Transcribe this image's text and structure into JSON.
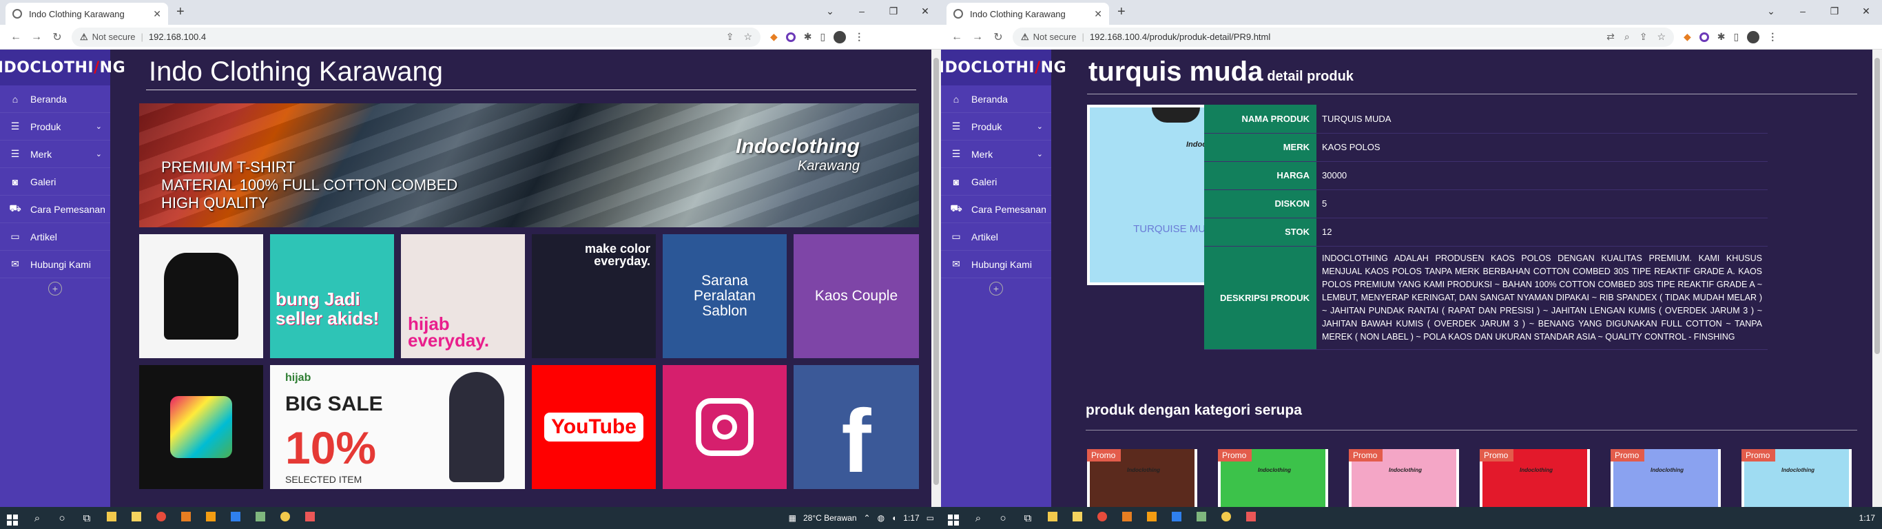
{
  "left": {
    "tab_title": "Indo Clothing Karawang",
    "not_secure": "Not secure",
    "url": "192.168.100.4",
    "logo_pre": "INDOCLOTHI",
    "logo_slash": "/",
    "logo_post": "NG",
    "site_title": "Indo Clothing Karawang",
    "hero": {
      "line1": "PREMIUM T-SHIRT",
      "line2": "MATERIAL 100% FULL COTTON COMBED",
      "line3": "HIGH QUALITY",
      "brand": "Indoclothing",
      "brand_sub": "Karawang"
    },
    "tiles": {
      "kids": "bung Jadi seller akids!",
      "hijab": "hijab everyday.",
      "stack": "make color everyday.",
      "alat": "Sarana Peralatan Sablon",
      "couple": "Kaos Couple",
      "sale_brand": "hijab",
      "sale_big": "BIG SALE",
      "sale_pct": "10%",
      "sale_off": "SELECTED ITEM",
      "youtube": "YouTube",
      "facebook": "f"
    }
  },
  "right": {
    "tab_title": "Indo Clothing Karawang",
    "not_secure": "Not secure",
    "url": "192.168.100.4/produk/produk-detail/PR9.html",
    "product_name_title": "turquis muda",
    "product_subtitle": "detail produk",
    "image_label": "TURQUISE MUDA",
    "image_brand": "Indoclothing",
    "details": [
      {
        "k": "NAMA PRODUK",
        "v": "TURQUIS MUDA"
      },
      {
        "k": "MERK",
        "v": "KAOS POLOS"
      },
      {
        "k": "HARGA",
        "v": "30000"
      },
      {
        "k": "DISKON",
        "v": "5"
      },
      {
        "k": "STOK",
        "v": "12"
      }
    ],
    "desc_label": "DESKRIPSI PRODUK",
    "desc_text": "INDOCLOTHING ADALAH PRODUSEN KAOS POLOS DENGAN KUALITAS PREMIUM. KAMI KHUSUS MENJUAL KAOS POLOS TANPA MERK BERBAHAN COTTON COMBED 30S TIPE REAKTIF GRADE A. KAOS POLOS PREMIUM YANG KAMI PRODUKSI ~ BAHAN 100% COTTON COMBED 30S TIPE REAKTIF GRADE A ~ LEMBUT, MENYERAP KERINGAT, DAN SANGAT NYAMAN DIPAKAI ~ RIB SPANDEX ( TIDAK MUDAH MELAR ) ~ JAHITAN PUNDAK RANTAI ( RAPAT DAN PRESISI ) ~ JAHITAN LENGAN KUMIS ( OVERDEK JARUM 3 ) ~ JAHITAN BAWAH KUMIS ( OVERDEK JARUM 3 ) ~ BENANG YANG DIGUNAKAN FULL COTTON ~ TANPA MEREK ( NON LABEL ) ~ POLA KAOS DAN UKURAN STANDAR ASIA ~ QUALITY CONTROL - FINSHING",
    "related_title": "produk dengan kategori serupa",
    "promo_label": "Promo",
    "related_brand": "Indoclothing",
    "related_colors": [
      "#5b2a1d",
      "#3cc24a",
      "#f4a6c6",
      "#e3192b",
      "#8aa2f0",
      "#9fdcf2"
    ]
  },
  "sidebar": {
    "items": [
      {
        "label": "Beranda",
        "icon": "home-icon"
      },
      {
        "label": "Produk",
        "icon": "list-icon"
      },
      {
        "label": "Merk",
        "icon": "list-icon"
      },
      {
        "label": "Galeri",
        "icon": "camera-icon"
      },
      {
        "label": "Cara Pemesanan",
        "icon": "cart-icon"
      },
      {
        "label": "Artikel",
        "icon": "laptop-icon"
      },
      {
        "label": "Hubungi Kami",
        "icon": "mail-icon"
      }
    ]
  },
  "taskbar": {
    "weather": "28°C Berawan",
    "time": "1:17",
    "time_right": "1:17"
  },
  "colors": {
    "sidebar": "#4e3bb0",
    "page_bg": "#2a1f4a",
    "label_cell": "#12805c"
  }
}
